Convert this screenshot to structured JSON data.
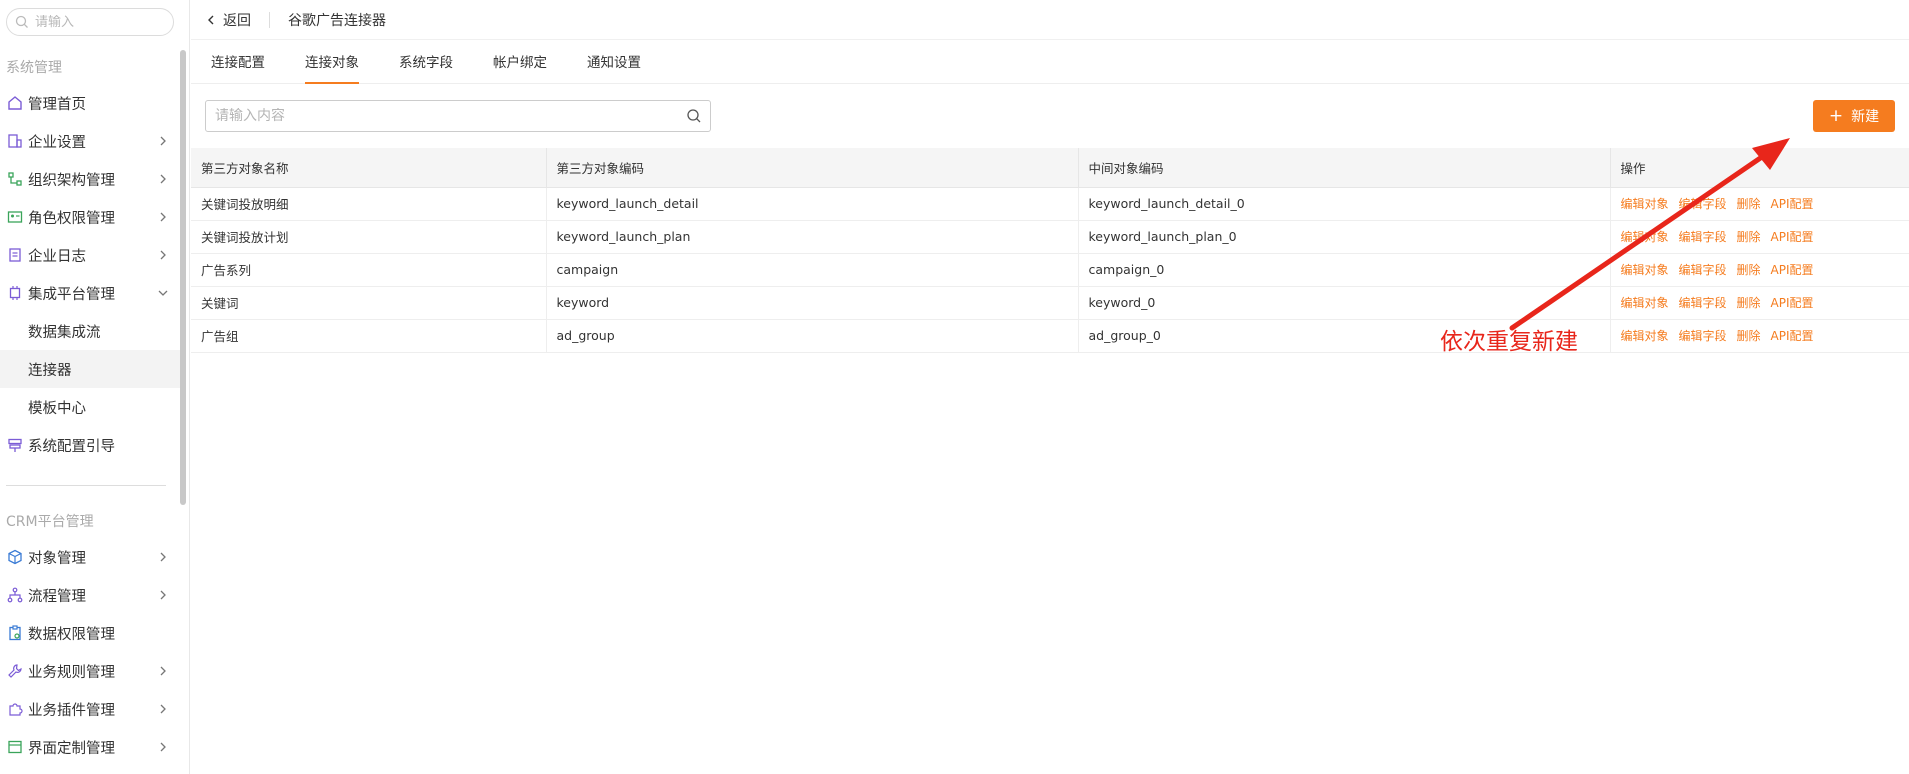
{
  "sidebar": {
    "search_placeholder": "请输入",
    "group1_title": "系统管理",
    "items": [
      {
        "label": "管理首页"
      },
      {
        "label": "企业设置"
      },
      {
        "label": "组织架构管理"
      },
      {
        "label": "角色权限管理"
      },
      {
        "label": "企业日志"
      },
      {
        "label": "集成平台管理"
      },
      {
        "label": "数据集成流"
      },
      {
        "label": "连接器"
      },
      {
        "label": "模板中心"
      },
      {
        "label": "系统配置引导"
      }
    ],
    "group2_title": "CRM平台管理",
    "items2": [
      {
        "label": "对象管理"
      },
      {
        "label": "流程管理"
      },
      {
        "label": "数据权限管理"
      },
      {
        "label": "业务规则管理"
      },
      {
        "label": "业务插件管理"
      },
      {
        "label": "界面定制管理"
      }
    ]
  },
  "header": {
    "back_label": "返回",
    "title": "谷歌广告连接器"
  },
  "tabs": [
    {
      "label": "连接配置"
    },
    {
      "label": "连接对象"
    },
    {
      "label": "系统字段"
    },
    {
      "label": "帐户绑定"
    },
    {
      "label": "通知设置"
    }
  ],
  "toolbar": {
    "search_placeholder": "请输入内容",
    "new_label": "新建"
  },
  "table": {
    "headers": [
      "第三方对象名称",
      "第三方对象编码",
      "中间对象编码",
      "操作"
    ],
    "rows": [
      [
        "关键词投放明细",
        "keyword_launch_detail",
        "keyword_launch_detail_0"
      ],
      [
        "关键词投放计划",
        "keyword_launch_plan",
        "keyword_launch_plan_0"
      ],
      [
        "广告系列",
        "campaign",
        "campaign_0"
      ],
      [
        "关键词",
        "keyword",
        "keyword_0"
      ],
      [
        "广告组",
        "ad_group",
        "ad_group_0"
      ]
    ],
    "ops": [
      "编辑对象",
      "编辑字段",
      "删除",
      "API配置"
    ]
  },
  "annotation": {
    "text": "依次重复新建",
    "color": "#e8261b"
  },
  "colors": {
    "accent": "#f57c1f"
  }
}
